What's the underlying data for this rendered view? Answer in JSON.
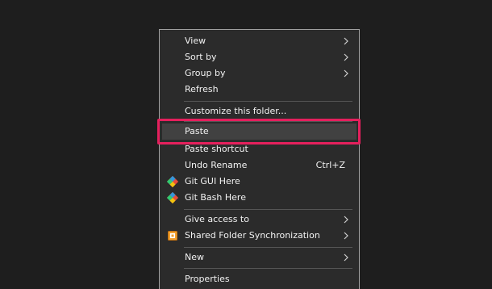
{
  "menu": {
    "items": [
      {
        "label": "View",
        "submenu": true
      },
      {
        "label": "Sort by",
        "submenu": true
      },
      {
        "label": "Group by",
        "submenu": true
      },
      {
        "label": "Refresh"
      },
      {
        "label": "Customize this folder..."
      },
      {
        "label": "Paste"
      },
      {
        "label": "Paste shortcut"
      },
      {
        "label": "Undo Rename",
        "shortcut": "Ctrl+Z"
      },
      {
        "label": "Git GUI Here",
        "icon": "git-gui-icon"
      },
      {
        "label": "Git Bash Here",
        "icon": "git-bash-icon"
      },
      {
        "label": "Give access to",
        "submenu": true
      },
      {
        "label": "Shared Folder Synchronization",
        "submenu": true,
        "icon": "shared-folder-sync-icon"
      },
      {
        "label": "New",
        "submenu": true
      },
      {
        "label": "Properties"
      }
    ]
  },
  "colors": {
    "background": "#1e1e1e",
    "menu_background": "#2b2b2b",
    "menu_text": "#f2f2f2",
    "highlight_row": "#414141",
    "annotation_border": "#e5205d"
  }
}
